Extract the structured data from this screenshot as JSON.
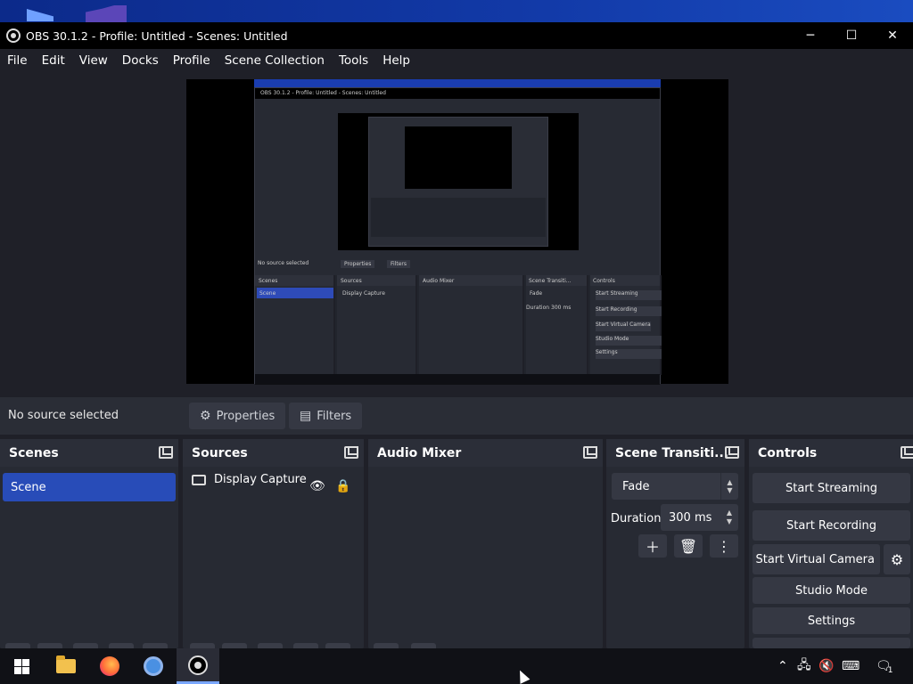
{
  "window": {
    "title": "OBS 30.1.2 - Profile: Untitled - Scenes: Untitled",
    "minimize": "─",
    "maximize": "☐",
    "close": "✕"
  },
  "menu": [
    "File",
    "Edit",
    "View",
    "Docks",
    "Profile",
    "Scene Collection",
    "Tools",
    "Help"
  ],
  "preview": {
    "inner_title": "OBS 30.1.2 - Profile: Untitled - Scenes: Untitled",
    "inner_no_source": "No source selected",
    "inner_properties": "Properties",
    "inner_filters": "Filters",
    "inner_scenes": "Scenes",
    "inner_sources": "Sources",
    "inner_mixer": "Audio Mixer",
    "inner_transitions": "Scene Transiti...",
    "inner_controls": "Controls",
    "inner_scene": "Scene",
    "inner_display": "Display Capture",
    "inner_fade": "Fade",
    "inner_duration": "Duration",
    "inner_ms": "300 ms",
    "inner_start_streaming": "Start Streaming",
    "inner_start_recording": "Start Recording",
    "inner_virtual": "Start Virtual Camera",
    "inner_studio": "Studio Mode",
    "inner_settings": "Settings"
  },
  "status": {
    "no_source": "No source selected",
    "properties": "Properties",
    "filters": "Filters"
  },
  "docks": {
    "scenes": {
      "title": "Scenes",
      "items": [
        "Scene"
      ]
    },
    "sources": {
      "title": "Sources",
      "items": [
        "Display Capture"
      ]
    },
    "audio_mixer": {
      "title": "Audio Mixer"
    },
    "transitions": {
      "title": "Scene Transiti...",
      "selected": "Fade",
      "duration_label": "Duration",
      "duration_value": "300 ms"
    },
    "controls": {
      "title": "Controls",
      "buttons": [
        "Start Streaming",
        "Start Recording",
        "Start Virtual Camera",
        "Studio Mode",
        "Settings"
      ]
    }
  },
  "taskbar": {
    "apps": [
      "windows-start",
      "file-explorer",
      "firefox",
      "chrome",
      "obs"
    ],
    "notification_count": "1"
  }
}
